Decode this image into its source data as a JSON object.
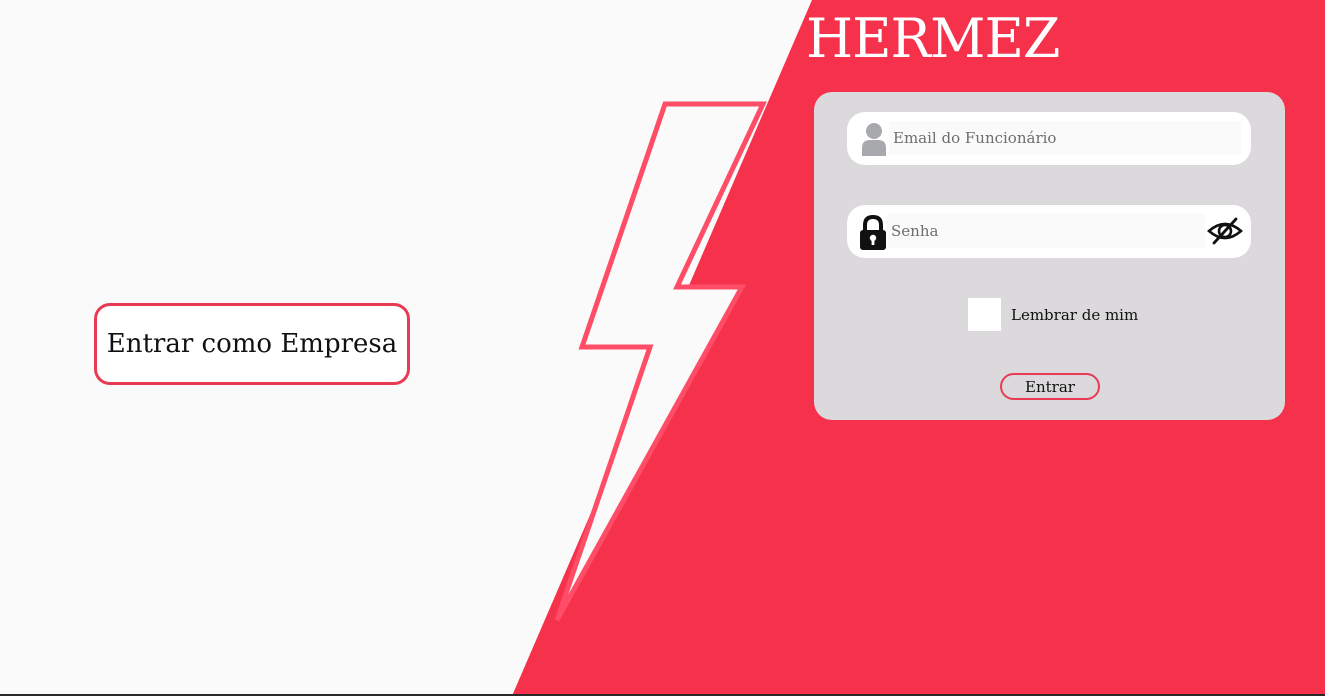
{
  "colors": {
    "accent": "#f5314b",
    "bolt_outline": "#ff4d68",
    "card_background": "#dbd9db",
    "page_background": "#fafafa"
  },
  "brand": {
    "name": "HERMEZ"
  },
  "company_login": {
    "label": "Entrar como Empresa"
  },
  "login_form": {
    "email": {
      "placeholder": "Email do Funcionário",
      "value": "",
      "icon": "user-icon"
    },
    "password": {
      "placeholder": "Senha",
      "value": "",
      "icon": "lock-icon",
      "toggle_icon": "eye-slash-icon"
    },
    "remember_me": {
      "label": "Lembrar de mim",
      "checked": false
    },
    "submit_label": "Entrar"
  }
}
